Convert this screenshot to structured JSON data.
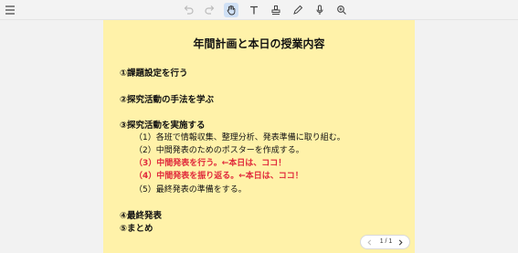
{
  "toolbar": {
    "icons": [
      "menu-icon",
      "undo-icon",
      "redo-icon",
      "pan-hand-icon",
      "text-icon",
      "stamp-icon",
      "pen-icon",
      "microphone-icon",
      "zoom-in-icon"
    ],
    "active": "pan-hand-icon"
  },
  "slide": {
    "title": "年間計画と本日の授業内容",
    "items": [
      {
        "text": "①課題設定を行う"
      },
      {
        "text": "②探究活動の手法を学ぶ"
      },
      {
        "text": "③探究活動を実施する"
      },
      {
        "text": "④最終発表"
      },
      {
        "text": "⑤まとめ"
      }
    ],
    "subitems": [
      {
        "text": "（1）各班で情報収集、整理分析、発表準備に取り組む。"
      },
      {
        "text": "（2）中間発表のためのポスターを作成する。"
      },
      {
        "text": "（3）中間発表を行う。←本日は、ココ！",
        "color": "#e0283a"
      },
      {
        "text": "（4）中間発表を振り返る。←本日は、ココ！",
        "color": "#e0283a"
      },
      {
        "text": "（5）最終発表の準備をする。"
      }
    ],
    "background": "#fff2a9"
  },
  "pager": {
    "current": "1 / 1"
  }
}
